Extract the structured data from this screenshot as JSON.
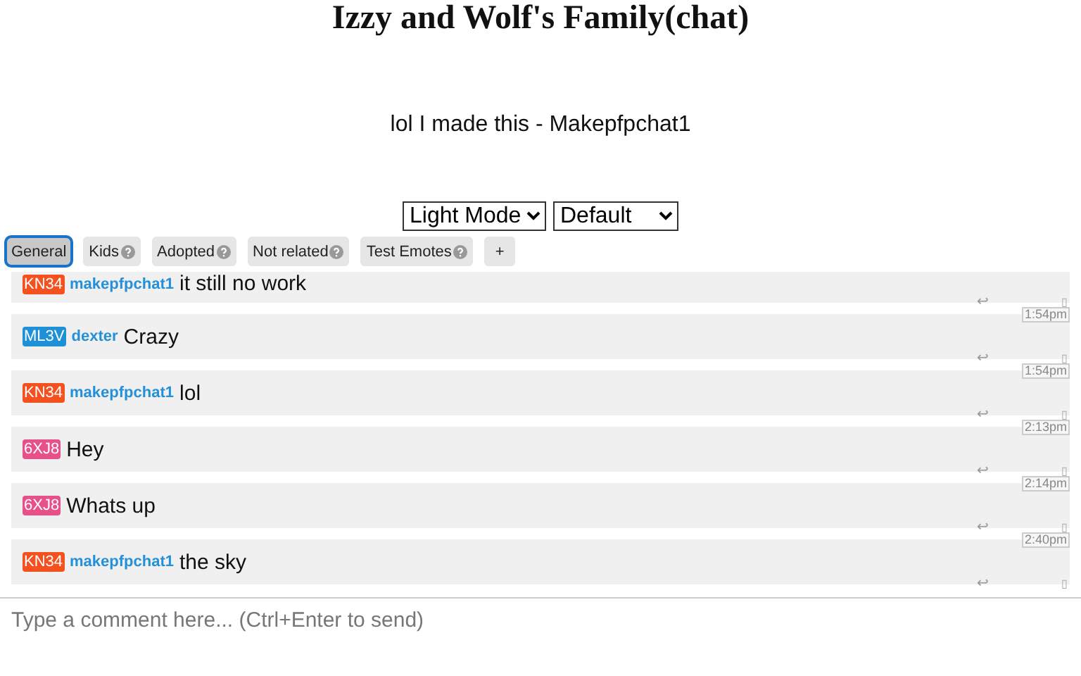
{
  "title": "Izzy and Wolf's Family(chat)",
  "subtitle": "lol I made this - Makepfpchat1",
  "theme_select": {
    "value": "Light Mode"
  },
  "style_select": {
    "value": "Default"
  },
  "tabs": [
    {
      "label": "General",
      "selected": true,
      "help": false
    },
    {
      "label": "Kids",
      "selected": false,
      "help": true
    },
    {
      "label": "Adopted",
      "selected": false,
      "help": true
    },
    {
      "label": "Not related",
      "selected": false,
      "help": true
    },
    {
      "label": "Test Emotes",
      "selected": false,
      "help": true
    }
  ],
  "add_tab": "+",
  "messages": [
    {
      "badge": "KN34",
      "color": "#f4511e",
      "user": "makepfpchat1",
      "text": "it still no work",
      "reply": "↩",
      "flag": "▯"
    },
    {
      "time": "1:54pm",
      "badge": "ML3V",
      "color": "#1e90d8",
      "user": "dexter",
      "text": "Crazy",
      "reply": "↩",
      "flag": "▯"
    },
    {
      "time": "1:54pm",
      "badge": "KN34",
      "color": "#f4511e",
      "user": "makepfpchat1",
      "text": "lol",
      "reply": "↩",
      "flag": "▯"
    },
    {
      "time": "2:13pm",
      "badge": "6XJ8",
      "color": "#e8508a",
      "text": "Hey",
      "reply": "↩",
      "flag": "▯"
    },
    {
      "time": "2:14pm",
      "badge": "6XJ8",
      "color": "#e8508a",
      "text": "Whats up",
      "reply": "↩",
      "flag": "▯"
    },
    {
      "time": "2:40pm",
      "badge": "KN34",
      "color": "#f4511e",
      "user": "makepfpchat1",
      "text": "the sky",
      "reply": "↩",
      "flag": "▯"
    }
  ],
  "comment": {
    "placeholder": "Type a comment here... (Ctrl+Enter to send)"
  }
}
